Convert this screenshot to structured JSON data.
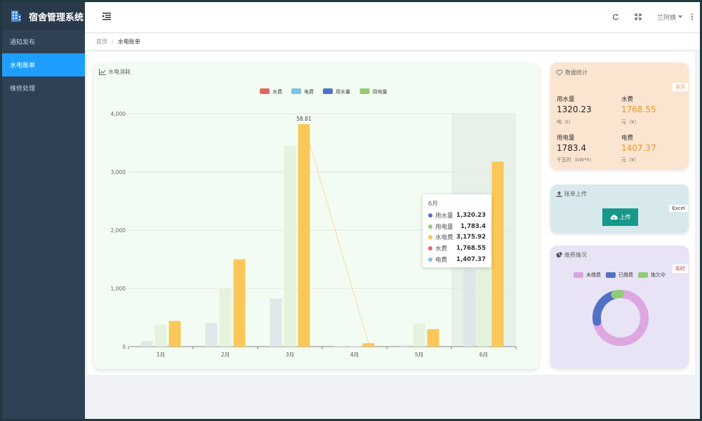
{
  "app": {
    "title": "宿舍管理系统"
  },
  "sidebar": {
    "items": [
      {
        "label": "通知发布",
        "active": false
      },
      {
        "label": "水电账单",
        "active": true
      },
      {
        "label": "维修处理",
        "active": false
      }
    ]
  },
  "header": {
    "user": "兰阿姨"
  },
  "breadcrumb": {
    "home": "首页",
    "separator": "/",
    "current": "水电账单"
  },
  "chart_card": {
    "title": "水电消耗"
  },
  "chart_data": {
    "type": "bar",
    "categories": [
      "1月",
      "2月",
      "3月",
      "4月",
      "5月",
      "6月"
    ],
    "ylim": [
      0,
      4000
    ],
    "yticks": [
      "0",
      "1,000",
      "2,000",
      "3,000",
      "4,000"
    ],
    "legend_position": "top-center",
    "series": [
      {
        "name": "水费",
        "color": "#e06666",
        "values": [
          95,
          405,
          825,
          5,
          25,
          1320
        ]
      },
      {
        "name": "电费",
        "color": "#7ec3e3",
        "values": [
          375,
          1000,
          3450,
          8,
          395,
          1783
        ]
      },
      {
        "name": "用水量",
        "color": "#5470c6",
        "values": [
          0,
          0,
          0,
          0,
          0,
          0
        ]
      },
      {
        "name": "用电量",
        "color": "#91cc75",
        "values": [
          0,
          0,
          0,
          0,
          0,
          0
        ]
      },
      {
        "name": "水电费",
        "color": "#fac858",
        "values": [
          440,
          1500,
          3820,
          58.81,
          300,
          3175.92
        ]
      }
    ],
    "line": {
      "values": [
        null,
        null,
        3820,
        58.81,
        null,
        null
      ]
    },
    "annotations": [
      {
        "category": "3月",
        "text": "58.81"
      }
    ]
  },
  "tooltip": {
    "title": "6月",
    "rows": [
      {
        "name": "用水量",
        "value": "1,320.23",
        "color": "#5470c6"
      },
      {
        "name": "用电量",
        "value": "1,783.4",
        "color": "#91cc75"
      },
      {
        "name": "水电费",
        "value": "3,175.92",
        "color": "#fac858"
      },
      {
        "name": "水费",
        "value": "1,768.55",
        "color": "#e06666"
      },
      {
        "name": "电费",
        "value": "1,407.37",
        "color": "#7ec3e3"
      }
    ]
  },
  "stats": {
    "title": "数据统计",
    "tag": "本月",
    "water_usage": {
      "label": "用水量",
      "value": "1320.23",
      "unit": "吨（t）"
    },
    "water_fee": {
      "label": "水费",
      "value": "1768.55",
      "unit": "元（¥）"
    },
    "power_usage": {
      "label": "用电量",
      "value": "1783.4",
      "unit": "千瓦时（kW*h）"
    },
    "power_fee": {
      "label": "电费",
      "value": "1407.37",
      "unit": "元（¥）"
    }
  },
  "upload": {
    "title": "账单上传",
    "tag": "Excel",
    "button": "上传"
  },
  "payment": {
    "title": "缴费情况",
    "tag": "实时",
    "legend": [
      {
        "name": "未缴费",
        "color": "#d9a3db"
      },
      {
        "name": "已缴费",
        "color": "#5470c6"
      },
      {
        "name": "拖欠中",
        "color": "#91cc75"
      }
    ],
    "donut": [
      {
        "name": "未缴费",
        "value": 72,
        "color": "#dda8e0"
      },
      {
        "name": "已缴费",
        "value": 24,
        "color": "#5470c6"
      },
      {
        "name": "拖欠中",
        "value": 4,
        "color": "#91cc75"
      }
    ]
  },
  "colors": {
    "sidebar_bg": "#304156",
    "active": "#1e9fff",
    "water_fee_value": "#e8952b",
    "power_fee_value": "#e8952b",
    "upload_button": "#16998a"
  }
}
